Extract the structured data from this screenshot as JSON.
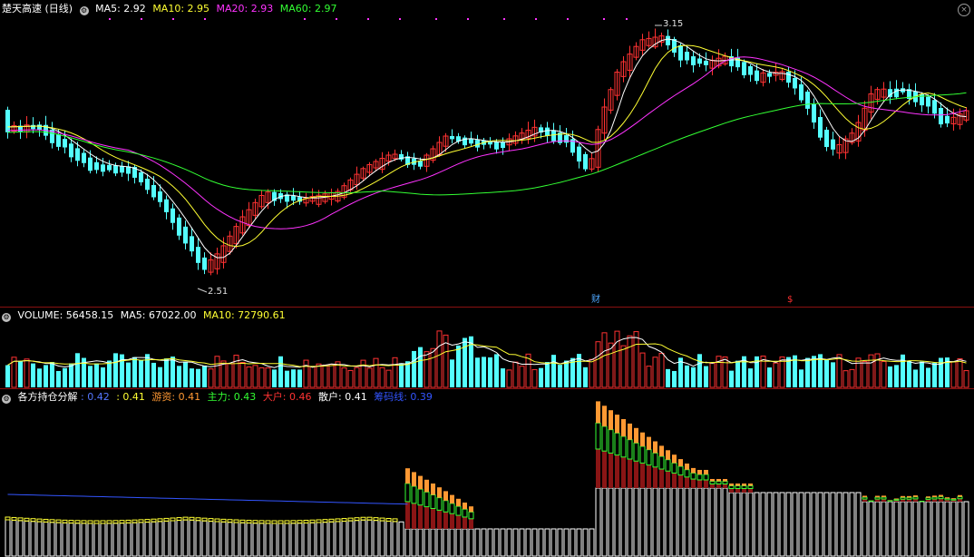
{
  "price_panel": {
    "title": "楚天高速 (日线)",
    "indicators": [
      {
        "label": "MA5: 2.92",
        "color": "#ffffff"
      },
      {
        "label": "MA10: 2.95",
        "color": "#ffff33"
      },
      {
        "label": "MA20: 2.93",
        "color": "#ff33ff"
      },
      {
        "label": "MA60: 2.97",
        "color": "#33ff33"
      }
    ],
    "high_label": "3.15",
    "low_label": "2.51",
    "event_marks": [
      {
        "label": "财",
        "color": "#4fa8ff"
      },
      {
        "label": "$",
        "color": "#ff3030"
      }
    ],
    "close_button": "×"
  },
  "volume_panel": {
    "indicators": [
      {
        "label": "VOLUME: 56458.15",
        "color": "#ffffff"
      },
      {
        "label": "MA5: 67022.00",
        "color": "#ffffff"
      },
      {
        "label": "MA10: 72790.61",
        "color": "#ffff33"
      }
    ]
  },
  "holding_panel": {
    "indicators": [
      {
        "label": "各方持仓分解",
        "color": "#ffffff"
      },
      {
        "label": ": 0.42",
        "color": "#5577ff"
      },
      {
        "label": ": 0.41",
        "color": "#ffff33"
      },
      {
        "label": "游资: 0.41",
        "color": "#ff9933"
      },
      {
        "label": "主力: 0.43",
        "color": "#33ff33"
      },
      {
        "label": "大户: 0.46",
        "color": "#ff3333"
      },
      {
        "label": "散户: 0.41",
        "color": "#ffffff"
      },
      {
        "label": "筹码线: 0.39",
        "color": "#3355ff"
      }
    ]
  },
  "colors": {
    "up": "#ff3232",
    "down": "#54ffff",
    "ma5": "#ffffff",
    "ma10": "#ffff33",
    "ma20": "#ff33ff",
    "ma60": "#33ff33",
    "separator": "#8a1010"
  }
}
